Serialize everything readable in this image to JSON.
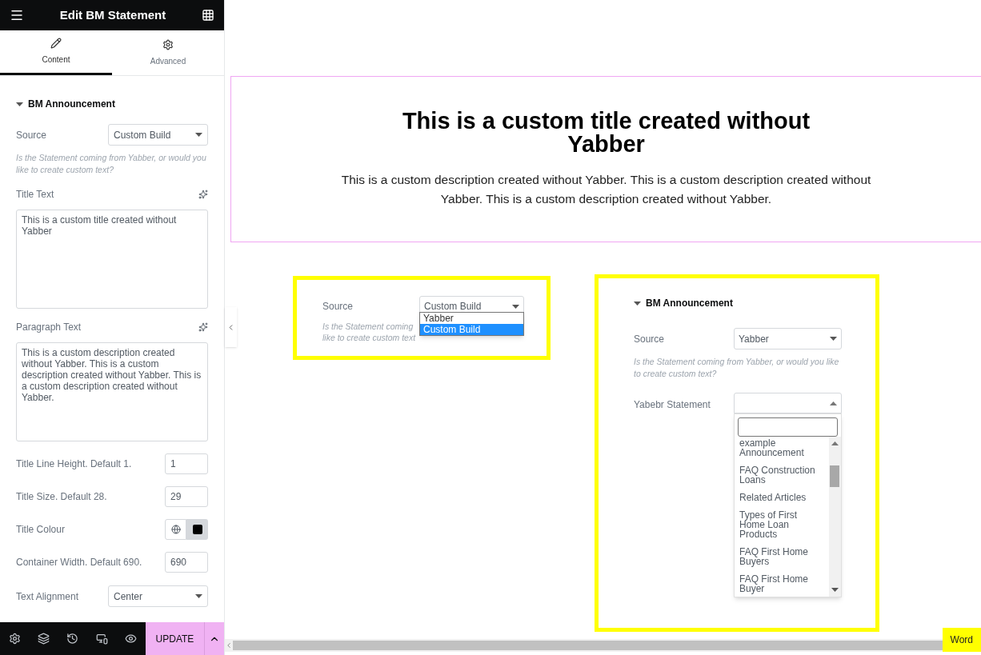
{
  "panel": {
    "title": "Edit BM Statement",
    "tabs": [
      {
        "label": "Content",
        "selected": true
      },
      {
        "label": "Advanced",
        "selected": false
      }
    ],
    "section": {
      "title": "BM Announcement",
      "expanded": true
    },
    "fields": [
      {
        "kind": "select",
        "label": "Source",
        "value": "Custom Build"
      },
      {
        "kind": "note",
        "text": "Is the Statement coming from Yabber, or would you like to create custom text?"
      },
      {
        "kind": "textarea",
        "label": "Title Text",
        "value": "This is a custom title created without Yabber"
      },
      {
        "kind": "textarea",
        "label": "Paragraph Text",
        "value": "This is a custom description created without Yabber. This is a custom description created without Yabber. This is a custom description created without Yabber."
      },
      {
        "kind": "number",
        "label": "Title Line Height. Default 1.",
        "value": "1"
      },
      {
        "kind": "number",
        "label": "Title Size. Default 28.",
        "value": "29"
      },
      {
        "kind": "color",
        "label": "Title Colour",
        "color": "#000000"
      },
      {
        "kind": "number",
        "label": "Container Width. Default 690.",
        "value": "690"
      },
      {
        "kind": "select",
        "label": "Text Alignment",
        "value": "Center"
      }
    ],
    "update_button": "UPDATE"
  },
  "canvas": {
    "title": "This is a custom title created without Yabber",
    "description": "This is a custom description created without Yabber. This is a custom description created without Yabber. This is a custom description created without Yabber.",
    "preview_left": {
      "label": "Source",
      "value": "Custom Build",
      "note_lines": [
        "Is the Statement coming",
        "like to create custom text"
      ],
      "options": [
        {
          "label": "Yabber",
          "selected": false
        },
        {
          "label": "Custom Build",
          "selected": true
        }
      ]
    },
    "preview_right": {
      "section": "BM Announcement",
      "expanded": true,
      "source_label": "Source",
      "source_value": "Yabber",
      "note": "Is the Statement coming from Yabber, or would you like to create custom text?",
      "statement_label": "Yabebr Statement",
      "options": [
        {
          "label": "example Announcement",
          "selected": false
        },
        {
          "label": "FAQ Construction Loans",
          "selected": false
        },
        {
          "label": "Related Articles",
          "selected": false
        },
        {
          "label": "Types of First Home Loan Products",
          "selected": false
        },
        {
          "label": "FAQ First Home Buyers",
          "selected": false
        },
        {
          "label": "FAQ First Home Buyer",
          "selected": false
        }
      ]
    },
    "badge": "Word"
  }
}
